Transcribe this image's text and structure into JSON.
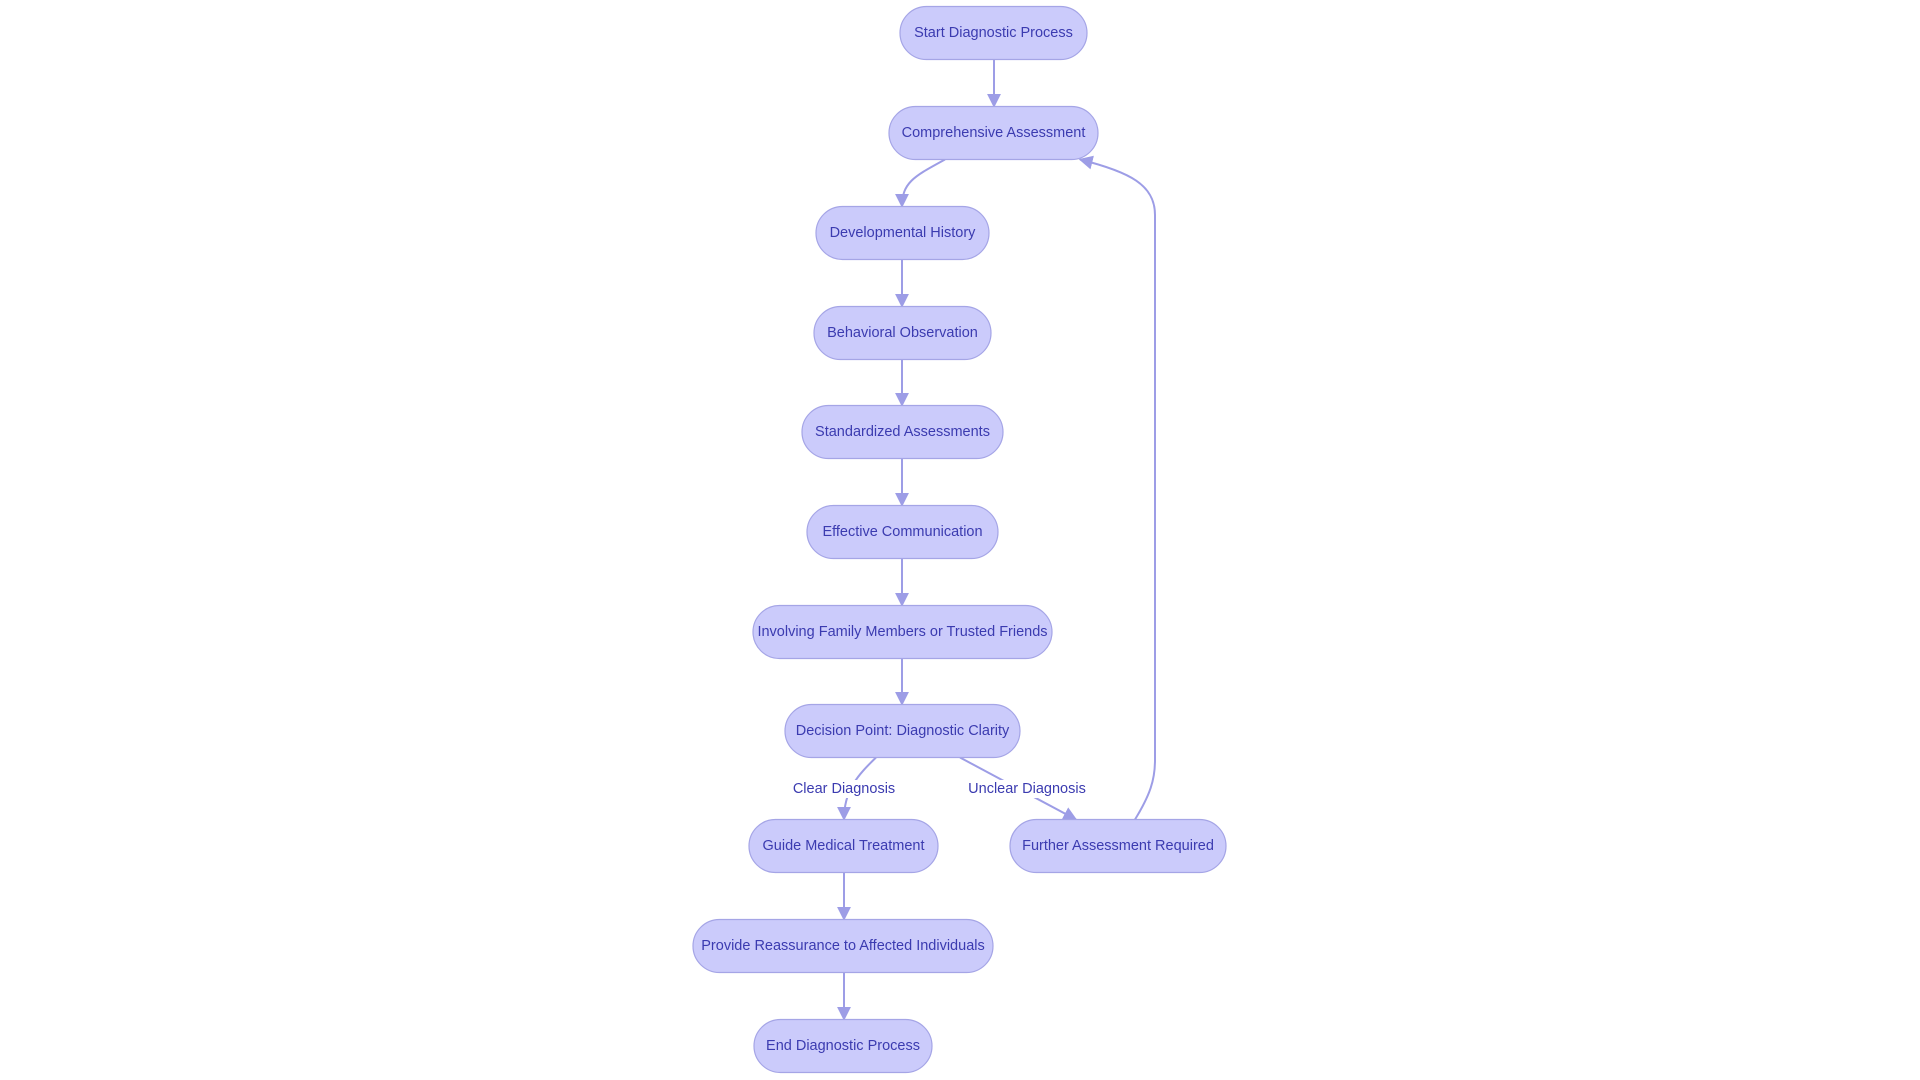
{
  "colors": {
    "node_fill": "#cbcbfb",
    "node_stroke": "#a5a5e6",
    "edge": "#9d9de6",
    "text": "#3b3bb0"
  },
  "nodes": [
    {
      "id": "start",
      "label": "Start Diagnostic Process"
    },
    {
      "id": "comprehensive",
      "label": "Comprehensive Assessment"
    },
    {
      "id": "developmental",
      "label": "Developmental History"
    },
    {
      "id": "behavioral",
      "label": "Behavioral Observation"
    },
    {
      "id": "standardized",
      "label": "Standardized Assessments"
    },
    {
      "id": "communication",
      "label": "Effective Communication"
    },
    {
      "id": "family",
      "label": "Involving Family Members or Trusted Friends"
    },
    {
      "id": "decision",
      "label": "Decision Point: Diagnostic Clarity"
    },
    {
      "id": "guide",
      "label": "Guide Medical Treatment"
    },
    {
      "id": "further",
      "label": "Further Assessment Required"
    },
    {
      "id": "reassurance",
      "label": "Provide Reassurance to Affected Individuals"
    },
    {
      "id": "end",
      "label": "End Diagnostic Process"
    }
  ],
  "edges": [
    {
      "from": "start",
      "to": "comprehensive",
      "label": ""
    },
    {
      "from": "comprehensive",
      "to": "developmental",
      "label": ""
    },
    {
      "from": "developmental",
      "to": "behavioral",
      "label": ""
    },
    {
      "from": "behavioral",
      "to": "standardized",
      "label": ""
    },
    {
      "from": "standardized",
      "to": "communication",
      "label": ""
    },
    {
      "from": "communication",
      "to": "family",
      "label": ""
    },
    {
      "from": "family",
      "to": "decision",
      "label": ""
    },
    {
      "from": "decision",
      "to": "guide",
      "label": "Clear Diagnosis"
    },
    {
      "from": "decision",
      "to": "further",
      "label": "Unclear Diagnosis"
    },
    {
      "from": "further",
      "to": "comprehensive",
      "label": ""
    },
    {
      "from": "guide",
      "to": "reassurance",
      "label": ""
    },
    {
      "from": "reassurance",
      "to": "end",
      "label": ""
    }
  ]
}
